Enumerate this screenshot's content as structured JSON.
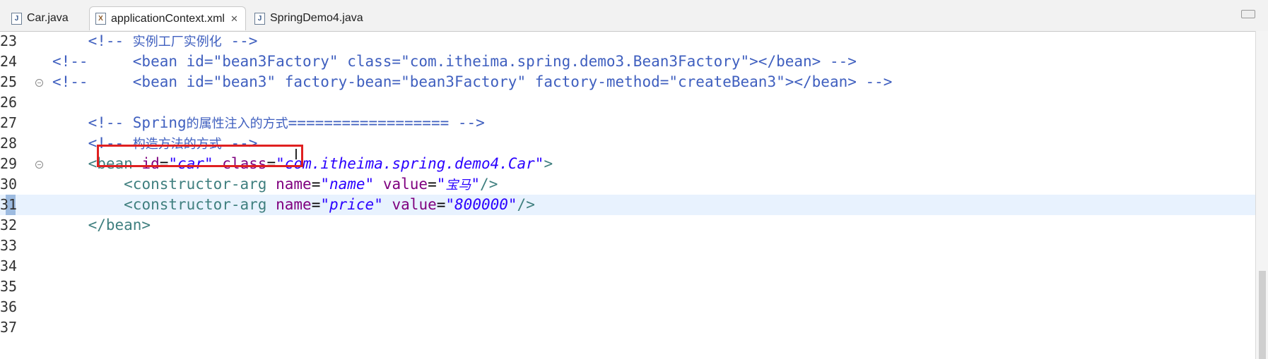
{
  "tabs": [
    {
      "label": "Car.java",
      "icon": "java-file-icon",
      "active": false
    },
    {
      "label": "applicationContext.xml",
      "icon": "xml-file-icon",
      "active": true,
      "close": "✕"
    },
    {
      "label": "SpringDemo4.java",
      "icon": "java-file-icon",
      "active": false
    }
  ],
  "lines": [
    {
      "num": "23",
      "text": "    <!-- 实例工厂实例化 -->"
    },
    {
      "num": "24",
      "text": "<!--     <bean id=\"bean3Factory\" class=\"com.itheima.spring.demo3.Bean3Factory\"></bean> -->"
    },
    {
      "num": "25",
      "text": "<!--     <bean id=\"bean3\" factory-bean=\"bean3Factory\" factory-method=\"createBean3\"></bean> -->"
    },
    {
      "num": "26",
      "text": ""
    },
    {
      "num": "27",
      "text": "    <!-- Spring的属性注入的方式================== -->"
    },
    {
      "num": "28",
      "text": "    <!-- 构造方法的方式 -->"
    },
    {
      "num": "29",
      "text": "    <bean id=\"car\" class=\"com.itheima.spring.demo4.Car\">"
    },
    {
      "num": "30",
      "text": "        <constructor-arg name=\"name\" value=\"宝马\"/>"
    },
    {
      "num": "31",
      "text": "        <constructor-arg name=\"price\" value=\"800000\"/>"
    },
    {
      "num": "32",
      "text": "    </bean>"
    },
    {
      "num": "33",
      "text": ""
    },
    {
      "num": "34",
      "text": ""
    },
    {
      "num": "35",
      "text": ""
    },
    {
      "num": "36",
      "text": ""
    },
    {
      "num": "37",
      "text": ""
    }
  ],
  "colors": {
    "comment": "#3f5fbf",
    "tag": "#3f7f7f",
    "attribute": "#7f007f",
    "value": "#2a00ff",
    "current_line": "#e8f2fe",
    "highlight_box": "#e02020"
  }
}
